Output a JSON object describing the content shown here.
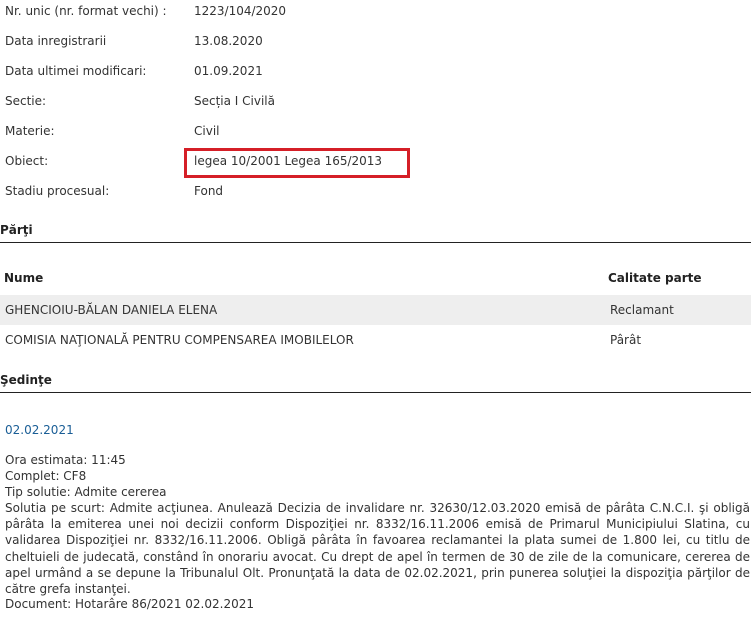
{
  "case_info": {
    "rows": [
      {
        "label": "Nr. unic (nr. format vechi) :",
        "value": "1223/104/2020"
      },
      {
        "label": "Data inregistrarii",
        "value": "13.08.2020"
      },
      {
        "label": "Data ultimei modificari:",
        "value": "01.09.2021"
      },
      {
        "label": "Sectie:",
        "value": "Secția I Civilă"
      },
      {
        "label": "Materie:",
        "value": "Civil"
      },
      {
        "label": "Obiect:",
        "value": "legea 10/2001 Legea 165/2013"
      },
      {
        "label": "Stadiu procesual:",
        "value": "Fond"
      }
    ],
    "highlight_color": "#d51f27"
  },
  "parti": {
    "title": "Părţi",
    "columns": [
      "Nume",
      "Calitate parte"
    ],
    "rows": [
      {
        "nume": "GHENCIOIU-BĂLAN DANIELA ELENA",
        "calitate": "Reclamant"
      },
      {
        "nume": "COMISIA NAŢIONALĂ PENTRU COMPENSAREA IMOBILELOR",
        "calitate": "Pârât"
      }
    ]
  },
  "sedinte": {
    "title": "Şedinţe",
    "date": "02.02.2021",
    "ora": "Ora estimata: 11:45",
    "complet": "Complet: CF8",
    "tip_solutie": "Tip solutie: Admite cererea",
    "summary": "Solutia pe scurt: Admite acţiunea. Anulează Decizia de invalidare nr. 32630/12.03.2020 emisă de pârâta C.N.C.I. şi obligă pârâta la emiterea unei noi decizii conform Dispoziţiei nr. 8332/16.11.2006 emisă de Primarul Municipiului Slatina, cu validarea Dispoziţiei nr. 8332/16.11.2006. Obligă pârâta în favoarea reclamantei la plata sumei de 1.800 lei, cu titlu de cheltuieli de judecată, constând în onorariu avocat. Cu drept de apel în termen de 30 de zile de la comunicare, cererea de apel urmând a se depune la Tribunalul Olt. Pronunţată la data de 02.02.2021, prin punerea soluţiei la dispoziţia părţilor de către grefa instanţei.",
    "document": "Document: Hotarâre  86/2021  02.02.2021"
  },
  "colors": {
    "link": "#1a5e96",
    "row_shade": "#eeeeee",
    "text": "#333333"
  }
}
